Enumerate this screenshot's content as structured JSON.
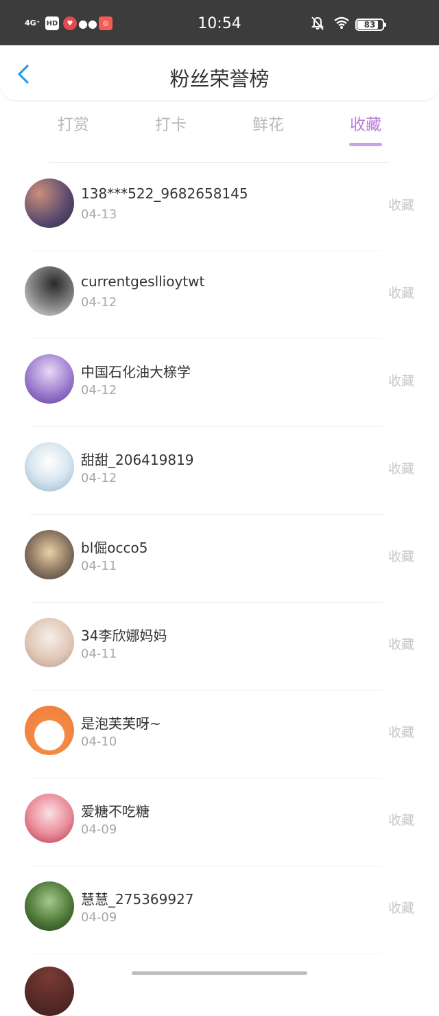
{
  "status_bar": {
    "time": "10:54",
    "network": "4G⁺",
    "hd_label": "HD",
    "battery": "83",
    "battery_fraction": 0.83,
    "icons": [
      "signal-icon",
      "hd-icon",
      "app-heart-icon",
      "wechat-icon",
      "app-icon",
      "mute-bell-icon",
      "wifi-icon",
      "battery-icon"
    ]
  },
  "header": {
    "title": "粉丝荣誉榜",
    "back_icon": "chevron-left-icon"
  },
  "tabs": [
    {
      "label": "打赏",
      "active": false
    },
    {
      "label": "打卡",
      "active": false
    },
    {
      "label": "鲜花",
      "active": false
    },
    {
      "label": "收藏",
      "active": true
    }
  ],
  "colors": {
    "accent": "#b77fd8",
    "indicator": "#caa3e6",
    "back_arrow": "#2c9ae8"
  },
  "fans": [
    {
      "name": "138***522_9682658145",
      "date": "04-13",
      "action": "收藏"
    },
    {
      "name": "currentgesllioytwt",
      "date": "04-12",
      "action": "收藏"
    },
    {
      "name": "中国石化油大榇学",
      "date": "04-12",
      "action": "收藏"
    },
    {
      "name": "甜甜_206419819",
      "date": "04-12",
      "action": "收藏"
    },
    {
      "name": "bl倔occo5",
      "date": "04-11",
      "action": "收藏"
    },
    {
      "name": "34李欣娜妈妈",
      "date": "04-11",
      "action": "收藏"
    },
    {
      "name": "是泡芙芙呀~",
      "date": "04-10",
      "action": "收藏"
    },
    {
      "name": "爱糖不吃糖",
      "date": "04-09",
      "action": "收藏"
    },
    {
      "name": "慧慧_275369927",
      "date": "04-09",
      "action": "收藏"
    }
  ]
}
